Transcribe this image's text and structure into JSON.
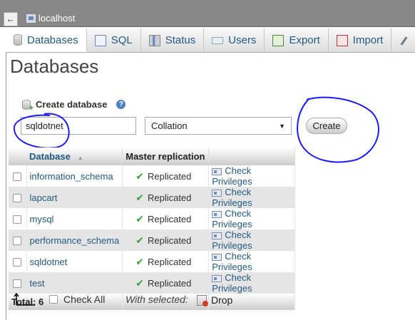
{
  "server": {
    "back_label": "←",
    "name": "localhost"
  },
  "tabs": [
    {
      "label": "Databases",
      "icon": "database-icon",
      "active": true
    },
    {
      "label": "SQL",
      "icon": "sql-icon"
    },
    {
      "label": "Status",
      "icon": "status-icon"
    },
    {
      "label": "Users",
      "icon": "users-icon"
    },
    {
      "label": "Export",
      "icon": "export-icon"
    },
    {
      "label": "Import",
      "icon": "import-icon"
    },
    {
      "label": "",
      "icon": "wrench-icon"
    }
  ],
  "page": {
    "title": "Databases"
  },
  "create": {
    "label": "Create database",
    "help": "?",
    "db_name_value": "sqldotnet",
    "collation_value": "Collation",
    "collation_arrow": "▼",
    "button_label": "Create"
  },
  "table": {
    "headers": {
      "database": "Database",
      "sort": "▲",
      "replication": "Master replication",
      "actions": ""
    },
    "rows": [
      {
        "name": "information_schema",
        "replication": "Replicated",
        "action": "Check Privileges"
      },
      {
        "name": "lapcart",
        "replication": "Replicated",
        "action": "Check Privileges"
      },
      {
        "name": "mysql",
        "replication": "Replicated",
        "action": "Check Privileges"
      },
      {
        "name": "performance_schema",
        "replication": "Replicated",
        "action": "Check Privileges"
      },
      {
        "name": "sqldotnet",
        "replication": "Replicated",
        "action": "Check Privileges"
      },
      {
        "name": "test",
        "replication": "Replicated",
        "action": "Check Privileges"
      }
    ],
    "total_label": "Total: 6"
  },
  "bulk": {
    "check_all_label": "Check All",
    "with_selected_label": "With selected:",
    "drop_label": "Drop"
  },
  "colors": {
    "link": "#235a81",
    "annotation": "#1a1aff",
    "replicated_check": "#3aa33a"
  }
}
